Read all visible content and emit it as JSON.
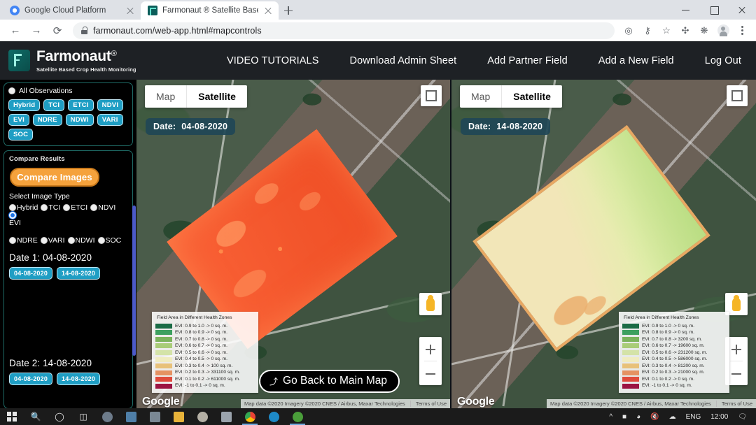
{
  "browser": {
    "tabs": [
      {
        "title": "Google Cloud Platform",
        "icon": "gcp-icon",
        "active": false
      },
      {
        "title": "Farmonaut ® Satellite Based Cro",
        "icon": "farmonaut-icon",
        "active": true
      }
    ],
    "new_tab_label": "+",
    "url": "farmonaut.com/web-app.html#mapcontrols",
    "nav": {
      "back": "←",
      "forward": "→",
      "reload": "⟳"
    },
    "toolbar_icons": [
      "target-icon",
      "key-icon",
      "star-icon",
      "crosshair-icon",
      "puzzle-icon",
      "profile-avatar",
      "kebab-menu-icon"
    ],
    "window_controls": [
      "minimize",
      "maximize",
      "close"
    ]
  },
  "site": {
    "brand_name": "Farmonaut",
    "brand_reg": "®",
    "tagline": "Satellite Based Crop Health Monitoring",
    "nav_links": [
      "VIDEO TUTORIALS",
      "Download Admin Sheet",
      "Add Partner Field",
      "Add a New Field",
      "Log Out"
    ]
  },
  "sidebar": {
    "all_observations_label": "All Observations",
    "index_chips": [
      "Hybrid",
      "TCI",
      "ETCI",
      "NDVI",
      "EVI",
      "NDRE",
      "NDWI",
      "VARI",
      "SOC"
    ],
    "compare_results_title": "Compare Results",
    "compare_button": "Compare Images",
    "select_image_type_label": "Select Image Type",
    "image_type_options_row1": [
      "Hybrid",
      "TCI",
      "ETCI",
      "NDVI",
      "EVI"
    ],
    "image_type_options_row2": [
      "NDRE",
      "VARI",
      "NDWI",
      "SOC"
    ],
    "selected_image_type": "EVI",
    "date1_label": "Date 1: 04-08-2020",
    "date1_buttons": [
      "04-08-2020",
      "14-08-2020"
    ],
    "date2_label": "Date 2: 14-08-2020",
    "date2_buttons": [
      "04-08-2020",
      "14-08-2020"
    ]
  },
  "maps": {
    "left": {
      "map_label": "Map",
      "satellite_label": "Satellite",
      "selected_type": "Satellite",
      "date_prefix": "Date:",
      "date_value": "04-08-2020",
      "google_watermark": "Google",
      "attribution": "Map data ©2020 Imagery ©2020 CNES / Airbus, Maxar Technologies",
      "terms": "Terms of Use",
      "legend_title": "Field Area in Different Health Zones",
      "legend_rows": [
        {
          "label": "EVI: 0.9 to 1.0 -> 0 sq. m.",
          "color": "#1a6b45"
        },
        {
          "label": "EVI: 0.8 to 0.9 -> 0 sq. m.",
          "color": "#3da05f"
        },
        {
          "label": "EVI: 0.7 to 0.8 -> 0 sq. m.",
          "color": "#7cb35c"
        },
        {
          "label": "EVI: 0.6 to 0.7 -> 0 sq. m.",
          "color": "#a9cc78"
        },
        {
          "label": "EVI: 0.5 to 0.6 -> 0 sq. m.",
          "color": "#d4e3a8"
        },
        {
          "label": "EVI: 0.4 to 0.5 -> 0 sq. m.",
          "color": "#f0ecc0"
        },
        {
          "label": "EVI: 0.3 to 0.4 -> 100 sq. m.",
          "color": "#e8c179"
        },
        {
          "label": "EVI: 0.2 to 0.3 -> 331100 sq. m.",
          "color": "#e59262"
        },
        {
          "label": "EVI: 0.1 to 0.2 -> 611000 sq. m.",
          "color": "#e04b3c"
        },
        {
          "label": "EVI: -1 to 0.1 -> 0 sq. m.",
          "color": "#9c1442"
        }
      ]
    },
    "right": {
      "map_label": "Map",
      "satellite_label": "Satellite",
      "selected_type": "Satellite",
      "date_prefix": "Date:",
      "date_value": "14-08-2020",
      "google_watermark": "Google",
      "attribution": "Map data ©2020 Imagery ©2020 CNES / Airbus, Maxar Technologies",
      "terms": "Terms of Use",
      "legend_title": "Field Area in Different Health Zones",
      "legend_rows": [
        {
          "label": "EVI: 0.9 to 1.0 -> 0 sq. m.",
          "color": "#1a6b45"
        },
        {
          "label": "EVI: 0.8 to 0.9 -> 0 sq. m.",
          "color": "#3da05f"
        },
        {
          "label": "EVI: 0.7 to 0.8 -> 3200 sq. m.",
          "color": "#7cb35c"
        },
        {
          "label": "EVI: 0.6 to 0.7 -> 19600 sq. m.",
          "color": "#a9cc78"
        },
        {
          "label": "EVI: 0.5 to 0.6 -> 231200 sq. m.",
          "color": "#d4e3a8"
        },
        {
          "label": "EVI: 0.4 to 0.5 -> 586000 sq. m.",
          "color": "#f0ecc0"
        },
        {
          "label": "EVI: 0.3 to 0.4 -> 81200 sq. m.",
          "color": "#e8c179"
        },
        {
          "label": "EVI: 0.2 to 0.3 -> 21000 sq. m.",
          "color": "#e59262"
        },
        {
          "label": "EVI: 0.1 to 0.2 -> 0 sq. m.",
          "color": "#e04b3c"
        },
        {
          "label": "EVI: -1 to 0.1 -> 0 sq. m.",
          "color": "#9c1442"
        }
      ]
    },
    "go_back_button": "Go Back to Main Map",
    "zoom_in": "+",
    "zoom_out": "−"
  },
  "taskbar": {
    "start": "windows-start-icon",
    "items": [
      "search-icon",
      "cortana-icon",
      "task-view-icon",
      "app-icon",
      "store-icon",
      "mail-icon",
      "explorer-icon",
      "paint-icon",
      "news-icon",
      "chrome-icon",
      "edge-icon",
      "app2-icon"
    ],
    "tray": [
      "chevron-up-icon",
      "battery-icon",
      "wifi-icon",
      "volume-muted-icon",
      "onedrive-icon"
    ],
    "language": "ENG",
    "clock": "12:00",
    "notifications": "notification-icon"
  },
  "colors": {
    "accent_teal": "#1f9ec4",
    "accent_orange": "#f5a23c",
    "panel_border": "#1f6b66",
    "header_bg": "#1e2125",
    "radio_selected": "#1a73e8"
  }
}
